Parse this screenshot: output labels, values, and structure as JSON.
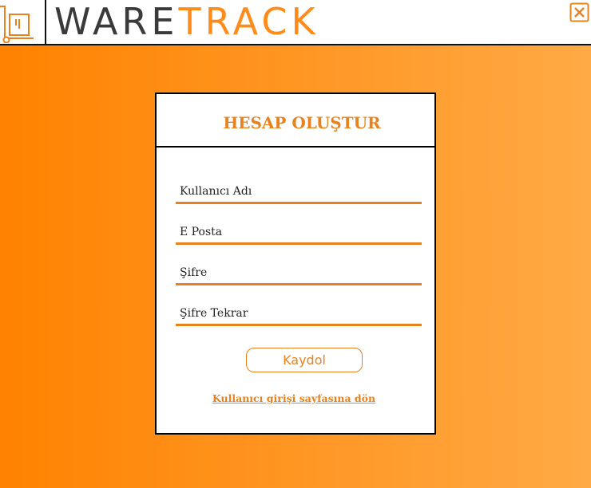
{
  "header": {
    "brand_part1": "WARE",
    "brand_part2": "TRACK",
    "logo_icon": "hand-truck-box-icon",
    "close_icon": "close-icon"
  },
  "form": {
    "title": "HESAP OLUŞTUR",
    "fields": [
      {
        "placeholder": "Kullanıcı Adı",
        "value": ""
      },
      {
        "placeholder": "E Posta",
        "value": ""
      },
      {
        "placeholder": "Şifre",
        "value": ""
      },
      {
        "placeholder": "Şifre Tekrar",
        "value": ""
      }
    ],
    "submit_label": "Kaydol",
    "back_link": "Kullanıcı girişi sayfasına dön"
  },
  "colors": {
    "accent": "#e8821e",
    "background_start": "#ff8200",
    "background_end": "#ffaa45",
    "brand_dark": "#3a3a3a"
  }
}
